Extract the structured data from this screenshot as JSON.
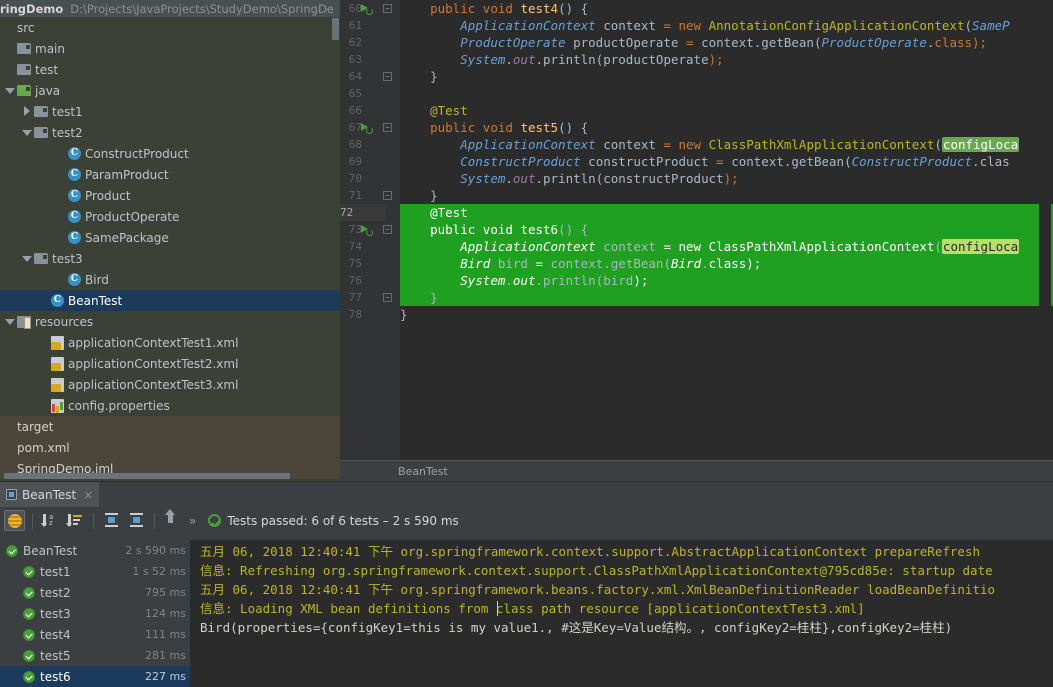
{
  "project": {
    "name": "ringDemo",
    "path": "D:\\Projects\\JavaProjects\\StudyDemo\\SpringDe",
    "tree": [
      {
        "label": "src",
        "indent": 0,
        "twist": "none",
        "icon": "none",
        "state": "normal"
      },
      {
        "label": "main",
        "indent": 0,
        "twist": "none",
        "icon": "folder",
        "state": "normal"
      },
      {
        "label": "test",
        "indent": 0,
        "twist": "none",
        "icon": "folder",
        "state": "normal"
      },
      {
        "label": "java",
        "indent": 0,
        "twist": "open",
        "icon": "folder-green",
        "state": "normal"
      },
      {
        "label": "test1",
        "indent": 1,
        "twist": "closed",
        "icon": "folder",
        "state": "normal"
      },
      {
        "label": "test2",
        "indent": 1,
        "twist": "open",
        "icon": "folder",
        "state": "normal"
      },
      {
        "label": "ConstructProduct",
        "indent": 3,
        "twist": "none",
        "icon": "class",
        "state": "normal"
      },
      {
        "label": "ParamProduct",
        "indent": 3,
        "twist": "none",
        "icon": "class",
        "state": "normal"
      },
      {
        "label": "Product",
        "indent": 3,
        "twist": "none",
        "icon": "class",
        "state": "normal"
      },
      {
        "label": "ProductOperate",
        "indent": 3,
        "twist": "none",
        "icon": "class",
        "state": "normal"
      },
      {
        "label": "SamePackage",
        "indent": 3,
        "twist": "none",
        "icon": "class",
        "state": "normal"
      },
      {
        "label": "test3",
        "indent": 1,
        "twist": "open",
        "icon": "folder",
        "state": "normal"
      },
      {
        "label": "Bird",
        "indent": 3,
        "twist": "none",
        "icon": "class",
        "state": "normal"
      },
      {
        "label": "BeanTest",
        "indent": 2,
        "twist": "none",
        "icon": "class",
        "state": "selected"
      },
      {
        "label": "resources",
        "indent": 0,
        "twist": "open",
        "icon": "resources",
        "state": "normal"
      },
      {
        "label": "applicationContextTest1.xml",
        "indent": 2,
        "twist": "none",
        "icon": "xml",
        "state": "normal"
      },
      {
        "label": "applicationContextTest2.xml",
        "indent": 2,
        "twist": "none",
        "icon": "xml",
        "state": "normal"
      },
      {
        "label": "applicationContextTest3.xml",
        "indent": 2,
        "twist": "none",
        "icon": "xml",
        "state": "normal"
      },
      {
        "label": "config.properties",
        "indent": 2,
        "twist": "none",
        "icon": "props",
        "state": "normal"
      },
      {
        "label": "target",
        "indent": 0,
        "twist": "none",
        "icon": "none",
        "state": "tan"
      },
      {
        "label": "pom.xml",
        "indent": 0,
        "twist": "none",
        "icon": "none",
        "state": "tan"
      },
      {
        "label": "SpringDemo.iml",
        "indent": 0,
        "twist": "none",
        "icon": "none",
        "state": "tan"
      }
    ]
  },
  "editor": {
    "breadcrumb": "BeanTest",
    "first_line_number": 60,
    "selection_start_line": 72,
    "selection_end_line": 77,
    "current_line": 72,
    "run_marker_lines": [
      60,
      67,
      73
    ],
    "lines": [
      {
        "n": 60,
        "text": "    public void test4() {"
      },
      {
        "n": 61,
        "text": "        ApplicationContext context = new AnnotationConfigApplicationContext(SameP"
      },
      {
        "n": 62,
        "text": "        ProductOperate productOperate = context.getBean(ProductOperate.class);"
      },
      {
        "n": 63,
        "text": "        System.out.println(productOperate);"
      },
      {
        "n": 64,
        "text": "    }"
      },
      {
        "n": 65,
        "text": ""
      },
      {
        "n": 66,
        "text": "    @Test"
      },
      {
        "n": 67,
        "text": "    public void test5() {"
      },
      {
        "n": 68,
        "text": "        ApplicationContext context = new ClassPathXmlApplicationContext(configLoca"
      },
      {
        "n": 69,
        "text": "        ConstructProduct constructProduct = context.getBean(ConstructProduct.clas"
      },
      {
        "n": 70,
        "text": "        System.out.println(constructProduct);"
      },
      {
        "n": 71,
        "text": "    }"
      },
      {
        "n": 72,
        "text": "    @Test"
      },
      {
        "n": 73,
        "text": "    public void test6() {"
      },
      {
        "n": 74,
        "text": "        ApplicationContext context = new ClassPathXmlApplicationContext(configLoca"
      },
      {
        "n": 75,
        "text": "        Bird bird = context.getBean(Bird.class);"
      },
      {
        "n": 76,
        "text": "        System.out.println(bird);"
      },
      {
        "n": 77,
        "text": "    }"
      },
      {
        "n": 78,
        "text": "}"
      }
    ],
    "chip_text": "configLoca"
  },
  "test_panel": {
    "tab_label": "BeanTest",
    "tab_close": "×",
    "toolbar": {
      "icons": [
        "show-passed-toggle",
        "sort-alphabetically-icon",
        "sort-by-duration-icon",
        "expand-all-icon",
        "collapse-all-icon",
        "scroll-up-icon",
        "more-options-icon"
      ],
      "more_label": "»"
    },
    "status": "Tests passed: 6 of 6 tests – 2 s 590 ms",
    "tests": [
      {
        "name": "BeanTest",
        "duration": "2 s 590 ms",
        "indent": 0,
        "state": "normal"
      },
      {
        "name": "test1",
        "duration": "1 s 52 ms",
        "indent": 1,
        "state": "normal"
      },
      {
        "name": "test2",
        "duration": "795 ms",
        "indent": 1,
        "state": "normal"
      },
      {
        "name": "test3",
        "duration": "124 ms",
        "indent": 1,
        "state": "normal"
      },
      {
        "name": "test4",
        "duration": "111 ms",
        "indent": 1,
        "state": "normal"
      },
      {
        "name": "test5",
        "duration": "281 ms",
        "indent": 1,
        "state": "normal"
      },
      {
        "name": "test6",
        "duration": "227 ms",
        "indent": 1,
        "state": "selected"
      }
    ]
  },
  "console": {
    "lines": [
      {
        "text": "五月 06, 2018 12:40:41 下午 org.springframework.context.support.AbstractApplicationContext prepareRefresh",
        "kind": "log"
      },
      {
        "text": "信息: Refreshing org.springframework.context.support.ClassPathXmlApplicationContext@795cd85e: startup date",
        "kind": "log"
      },
      {
        "text": "五月 06, 2018 12:40:41 下午 org.springframework.beans.factory.xml.XmlBeanDefinitionReader loadBeanDefinitio",
        "kind": "log"
      },
      {
        "text": "信息: Loading XML bean definitions from class path resource [applicationContextTest3.xml]",
        "kind": "log"
      },
      {
        "text": "Bird(properties={configKey1=this is my value1., #这是Key=Value结构。, configKey2=桂柱},configKey2=桂柱)",
        "kind": "out"
      }
    ]
  },
  "colors": {
    "accent_green": "#20a020",
    "selection_blue": "#1b3a5c",
    "editor_bg": "#2b2b2b",
    "panel_bg": "#3c3f41",
    "project_bg": "#3c4138",
    "pass_green": "#4c9e3a",
    "keyword_orange": "#cc7832",
    "annotation_yellow": "#bbb529",
    "class_blue": "#6a9fd4",
    "method_gold": "#ffc66d",
    "field_purple": "#9876aa"
  }
}
